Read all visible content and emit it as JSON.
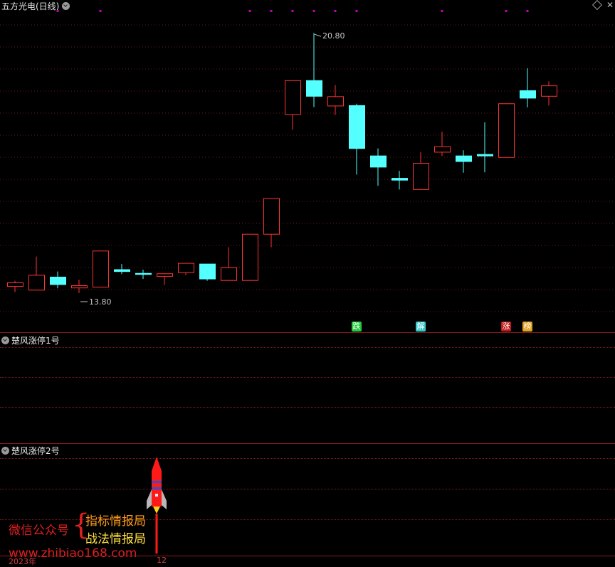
{
  "header": {
    "stock_title": "五方光电(日线)"
  },
  "panels": {
    "indicator1_title": "楚风涨停1号",
    "indicator2_title": "楚风涨停2号"
  },
  "chart_data": {
    "type": "candlestick",
    "ylim": [
      13.0,
      21.3
    ],
    "max_label": "20.80",
    "min_label": "13.80",
    "candles": [
      {
        "o": 14.0,
        "h": 14.15,
        "l": 13.85,
        "c": 14.1
      },
      {
        "o": 13.9,
        "h": 14.8,
        "l": 13.9,
        "c": 14.3
      },
      {
        "o": 14.25,
        "h": 14.4,
        "l": 13.95,
        "c": 14.05
      },
      {
        "o": 13.96,
        "h": 14.18,
        "l": 13.82,
        "c": 14.02
      },
      {
        "o": 13.98,
        "h": 14.9,
        "l": 13.98,
        "c": 14.95
      },
      {
        "o": 14.45,
        "h": 14.6,
        "l": 14.33,
        "c": 14.4
      },
      {
        "o": 14.35,
        "h": 14.45,
        "l": 14.2,
        "c": 14.34
      },
      {
        "o": 14.27,
        "h": 14.35,
        "l": 14.04,
        "c": 14.34
      },
      {
        "o": 14.37,
        "h": 14.6,
        "l": 14.3,
        "c": 14.62
      },
      {
        "o": 14.6,
        "h": 14.6,
        "l": 14.15,
        "c": 14.2
      },
      {
        "o": 14.16,
        "h": 15.05,
        "l": 14.16,
        "c": 14.5
      },
      {
        "o": 14.16,
        "h": 15.4,
        "l": 14.16,
        "c": 15.4
      },
      {
        "o": 15.4,
        "h": 16.36,
        "l": 15.05,
        "c": 16.36
      },
      {
        "o": 18.61,
        "h": 18.61,
        "l": 18.2,
        "c": 19.52
      },
      {
        "o": 19.52,
        "h": 20.8,
        "l": 18.81,
        "c": 19.1
      },
      {
        "o": 18.84,
        "h": 19.4,
        "l": 18.6,
        "c": 19.09
      },
      {
        "o": 18.85,
        "h": 18.9,
        "l": 17.0,
        "c": 17.7
      },
      {
        "o": 17.5,
        "h": 17.7,
        "l": 16.7,
        "c": 17.2
      },
      {
        "o": 16.9,
        "h": 17.1,
        "l": 16.6,
        "c": 16.85
      },
      {
        "o": 16.6,
        "h": 17.6,
        "l": 16.6,
        "c": 17.3
      },
      {
        "o": 17.6,
        "h": 18.15,
        "l": 17.5,
        "c": 17.75
      },
      {
        "o": 17.5,
        "h": 17.65,
        "l": 17.05,
        "c": 17.35
      },
      {
        "o": 17.54,
        "h": 18.4,
        "l": 17.06,
        "c": 17.5
      },
      {
        "o": 17.46,
        "h": 18.9,
        "l": 17.46,
        "c": 18.9
      },
      {
        "o": 19.25,
        "h": 19.85,
        "l": 18.8,
        "c": 19.05
      },
      {
        "o": 19.1,
        "h": 19.5,
        "l": 18.85,
        "c": 19.38
      }
    ],
    "top_markers_index": [
      2,
      4,
      11,
      12,
      13,
      14,
      15,
      16,
      20,
      23,
      24
    ]
  },
  "signals": [
    {
      "label": "跌",
      "color": "#22c93a",
      "text_color": "#ffffff"
    },
    {
      "label": "解",
      "color": "#36c8c8",
      "text_color": "#ffffff"
    },
    {
      "label": "涨",
      "color": "#c01818",
      "text_color": "#ffffff"
    },
    {
      "label": "榜",
      "color": "#e0a020",
      "text_color": "#ffffff"
    }
  ],
  "promo": {
    "label": "微信公众号",
    "line1": "指标情报局",
    "line2": "战法情报局",
    "site": "www.zhibiao168.com"
  },
  "axis": {
    "year": "2023年",
    "month": "12"
  },
  "colors": {
    "up": "#ff3333",
    "down": "#54ffff",
    "marker": "#c000c0",
    "separator": "#8b1a1a"
  }
}
